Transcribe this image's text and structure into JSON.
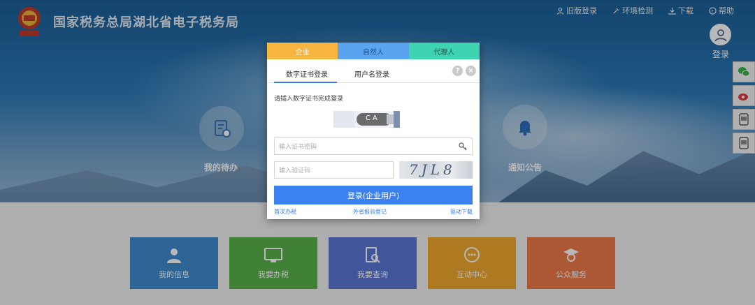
{
  "header": {
    "site_title": "国家税务总局湖北省电子税务局",
    "links": [
      "旧版登录",
      "环境检测",
      "下载",
      "帮助"
    ],
    "login_label": "登录"
  },
  "hero": {
    "items": [
      "我的待办",
      "通知公告"
    ]
  },
  "tiles": [
    {
      "label": "我的信息",
      "color": "#3d8bd0"
    },
    {
      "label": "我要办税",
      "color": "#5ab34a"
    },
    {
      "label": "我要查询",
      "color": "#5a78d6"
    },
    {
      "label": "互动中心",
      "color": "#f0a92e"
    },
    {
      "label": "公众服务",
      "color": "#f07a4a"
    }
  ],
  "modal": {
    "role_tabs": [
      "企业",
      "自然人",
      "代理人"
    ],
    "mode_tabs": [
      "数字证书登录",
      "用户名登录"
    ],
    "hint": "请插入数字证书完成登录",
    "ca_label": "CA",
    "password_placeholder": "输入证书密码",
    "captcha_placeholder": "输入验证码",
    "captcha_text": "7JL8",
    "submit_label": "登录(企业用户)",
    "footer_links": [
      "首次办税",
      "外省报验登记",
      "驱动下载"
    ]
  },
  "colors": {
    "enterprise_tab": "#f5b53f",
    "individual_tab": "#5aa4ef",
    "agent_tab": "#3fd4b1",
    "primary": "#3b82f0"
  }
}
